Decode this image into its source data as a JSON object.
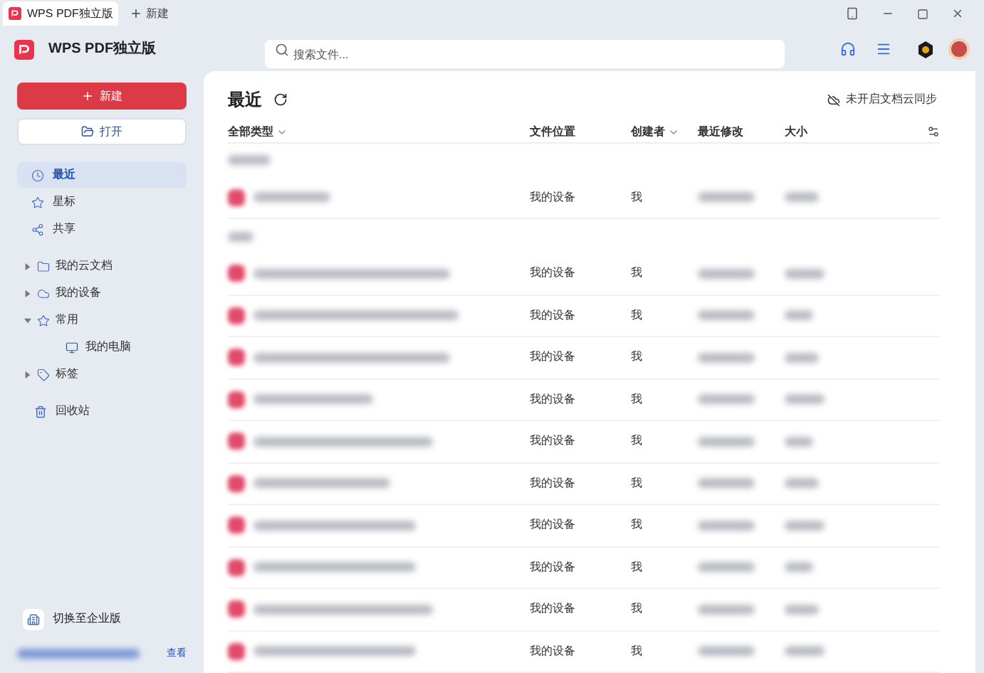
{
  "tabs": [
    {
      "label": "WPS PDF独立版",
      "selected": true
    }
  ],
  "new_tab": {
    "label": "新建"
  },
  "app": {
    "name": "WPS PDF独立版"
  },
  "search": {
    "placeholder": "搜索文件..."
  },
  "sidebar": {
    "new_button": "新建",
    "open_button": "打开",
    "items": [
      {
        "label": "最近",
        "selected": true
      },
      {
        "label": "星标",
        "selected": false
      },
      {
        "label": "共享",
        "selected": false
      }
    ],
    "tree": [
      {
        "label": "我的云文档",
        "expanded": false
      },
      {
        "label": "我的设备",
        "expanded": false
      },
      {
        "label": "常用",
        "expanded": true,
        "children": [
          {
            "label": "我的电脑"
          }
        ]
      },
      {
        "label": "标签",
        "expanded": false
      }
    ],
    "trash": "回收站",
    "enterprise": "切换至企业版",
    "view_link": "查看"
  },
  "main": {
    "title": "最近",
    "sync": "未开启文档云同步",
    "columns": [
      {
        "label": "全部类型",
        "dropdown": true
      },
      {
        "label": "文件位置",
        "dropdown": false
      },
      {
        "label": "创建者",
        "dropdown": true
      },
      {
        "label": "最近修改",
        "dropdown": false
      },
      {
        "label": "大小",
        "dropdown": false
      }
    ],
    "rows": [
      {
        "kind": "group"
      },
      {
        "kind": "file",
        "location": "我的设备",
        "creator": "我"
      },
      {
        "kind": "group"
      },
      {
        "kind": "file",
        "location": "我的设备",
        "creator": "我"
      },
      {
        "kind": "file",
        "location": "我的设备",
        "creator": "我"
      },
      {
        "kind": "file",
        "location": "我的设备",
        "creator": "我"
      },
      {
        "kind": "file",
        "location": "我的设备",
        "creator": "我"
      },
      {
        "kind": "file",
        "location": "我的设备",
        "creator": "我"
      },
      {
        "kind": "file",
        "location": "我的设备",
        "creator": "我"
      },
      {
        "kind": "file",
        "location": "我的设备",
        "creator": "我"
      },
      {
        "kind": "file",
        "location": "我的设备",
        "creator": "我"
      },
      {
        "kind": "file",
        "location": "我的设备",
        "creator": "我"
      },
      {
        "kind": "file",
        "location": "我的设备",
        "creator": "我"
      }
    ]
  }
}
